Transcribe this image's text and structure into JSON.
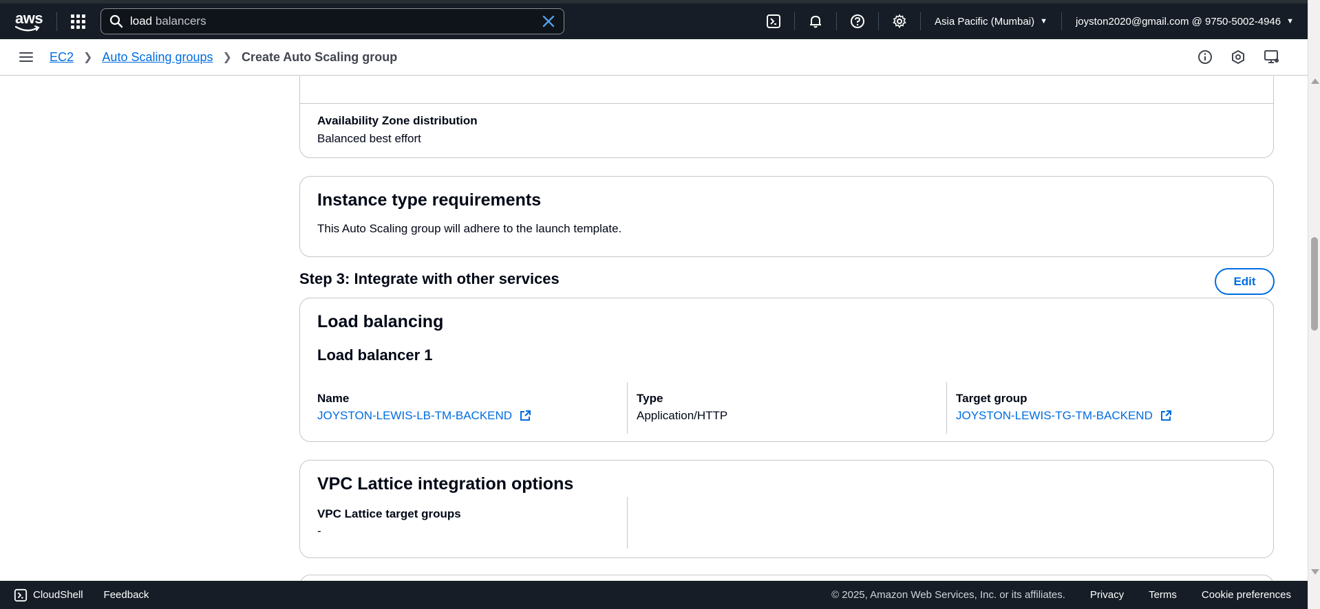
{
  "topnav": {
    "logo_text": "aws",
    "search": {
      "typed": "load",
      "suggestion": " balancers"
    },
    "region": "Asia Pacific (Mumbai)",
    "account": "joyston2020@gmail.com @ 9750-5002-4946",
    "icons": [
      "cloudshell-icon",
      "bell-icon",
      "help-icon",
      "gear-icon"
    ]
  },
  "breadcrumb": {
    "items": [
      "EC2",
      "Auto Scaling groups"
    ],
    "current": "Create Auto Scaling group"
  },
  "az_card": {
    "label": "Availability Zone distribution",
    "value": "Balanced best effort"
  },
  "instance_card": {
    "title": "Instance type requirements",
    "description": "This Auto Scaling group will adhere to the launch template."
  },
  "step3": {
    "title": "Step 3: Integrate with other services",
    "edit_label": "Edit"
  },
  "load_balancing": {
    "title": "Load balancing",
    "subtitle": "Load balancer 1",
    "name_label": "Name",
    "name_value": "JOYSTON-LEWIS-LB-TM-BACKEND",
    "type_label": "Type",
    "type_value": "Application/HTTP",
    "tg_label": "Target group",
    "tg_value": "JOYSTON-LEWIS-TG-TM-BACKEND"
  },
  "vpc_lattice": {
    "title": "VPC Lattice integration options",
    "label": "VPC Lattice target groups",
    "value": "-"
  },
  "footer": {
    "cloudshell": "CloudShell",
    "feedback": "Feedback",
    "copyright": "© 2025, Amazon Web Services, Inc. or its affiliates.",
    "privacy": "Privacy",
    "terms": "Terms",
    "cookies": "Cookie preferences"
  }
}
